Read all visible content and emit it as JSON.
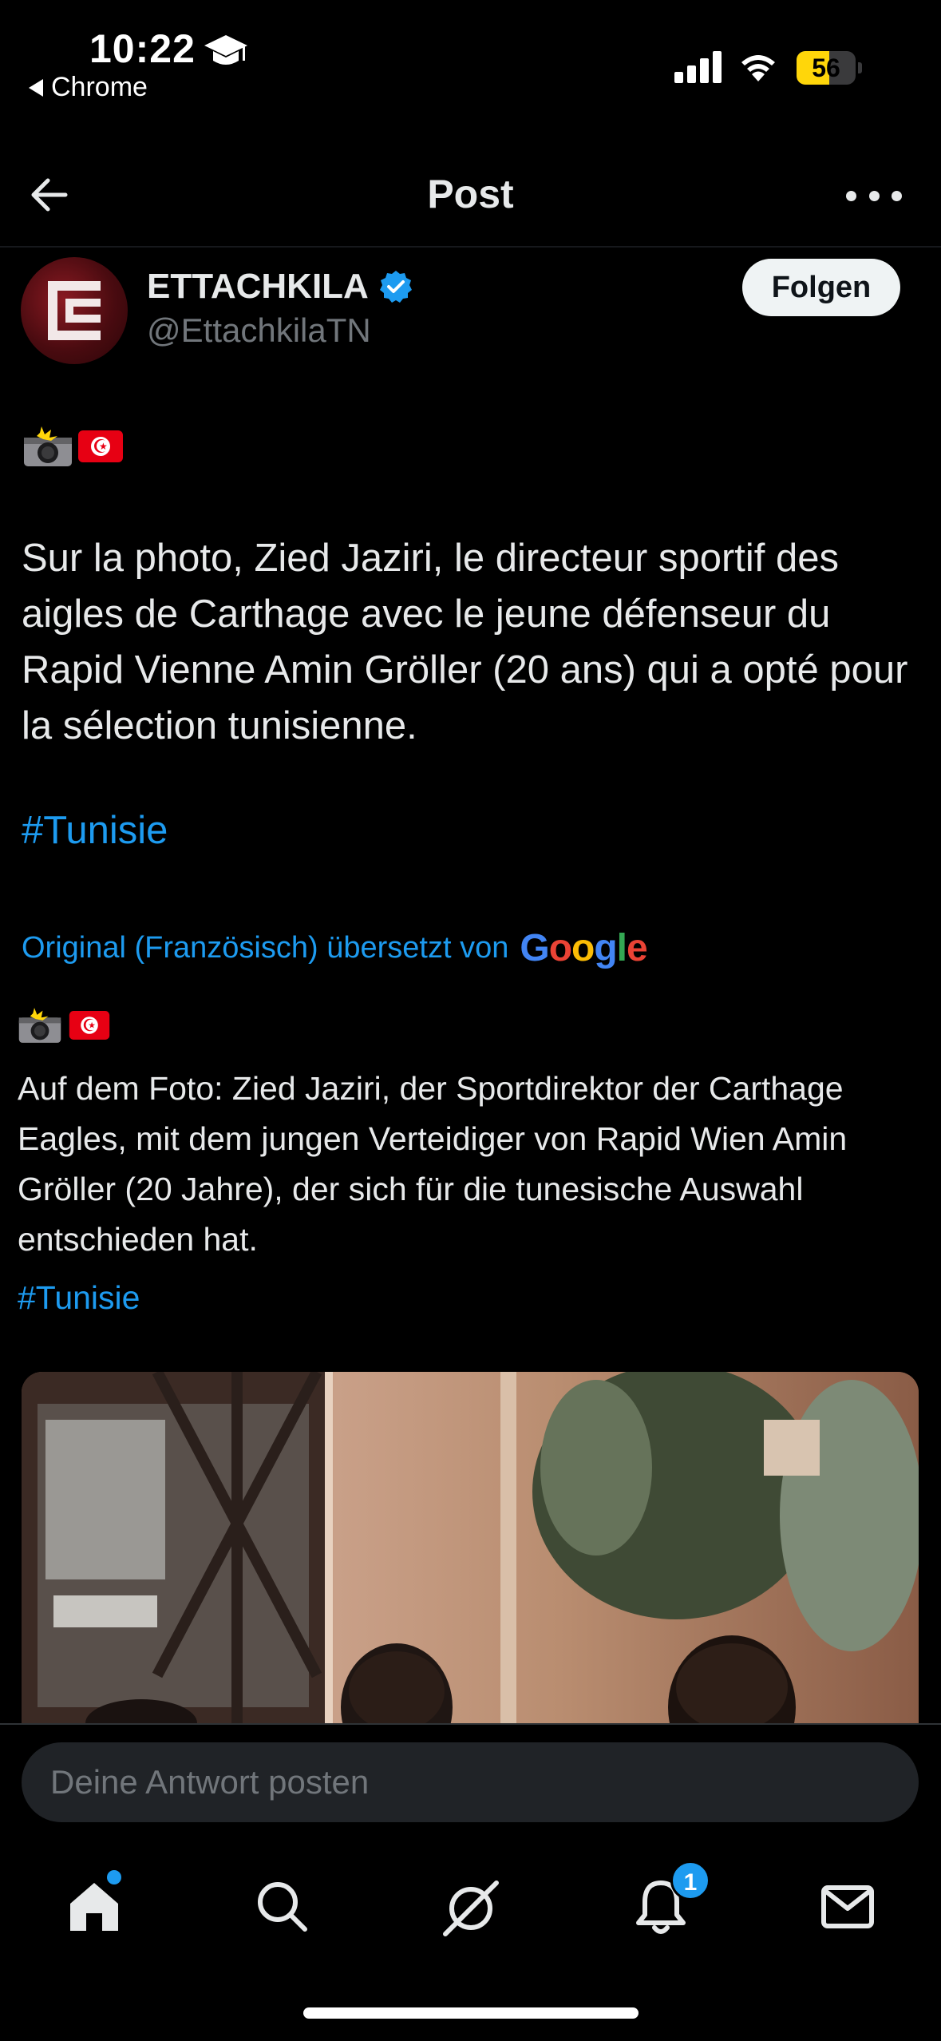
{
  "status_bar": {
    "time": "10:22",
    "back_app": "Chrome",
    "battery_level": "56",
    "battery_fraction": 0.56
  },
  "header": {
    "title": "Post",
    "back_icon": "arrow-left-icon",
    "more_icon": "more-horizontal-icon"
  },
  "author": {
    "name": "ETTACHKILA",
    "handle": "@EttachkilaTN",
    "verified": true,
    "follow_label": "Folgen"
  },
  "post": {
    "emojis": [
      "camera-with-flash",
      "flag-tunisia"
    ],
    "text": "Sur la photo, Zied Jaziri, le directeur sportif des aigles de Carthage avec le jeune défenseur du Rapid Vienne Amin Gröller (20 ans) qui a opté pour la sélection tunisienne.",
    "hashtag": "#Tunisie"
  },
  "translation": {
    "label": "Original (Französisch) übersetzt von",
    "provider": "Google",
    "text": "Auf dem Foto: Zied Jaziri, der Sportdirektor der Carthage Eagles, mit dem jungen Verteidiger von Rapid Wien Amin Gröller (20 Jahre), der sich für die tunesische Auswahl entschieden hat.",
    "hashtag": "#Tunisie"
  },
  "reply": {
    "placeholder": "Deine Antwort posten"
  },
  "tabs": [
    {
      "name": "home",
      "icon": "home-icon",
      "has_dot": true
    },
    {
      "name": "search",
      "icon": "search-icon"
    },
    {
      "name": "grok",
      "icon": "grok-icon"
    },
    {
      "name": "notifications",
      "icon": "bell-icon",
      "badge": "1"
    },
    {
      "name": "messages",
      "icon": "mail-icon"
    }
  ],
  "colors": {
    "accent": "#1d9bf0",
    "background": "#000000",
    "text": "#e7e9ea",
    "muted": "#71767b"
  }
}
